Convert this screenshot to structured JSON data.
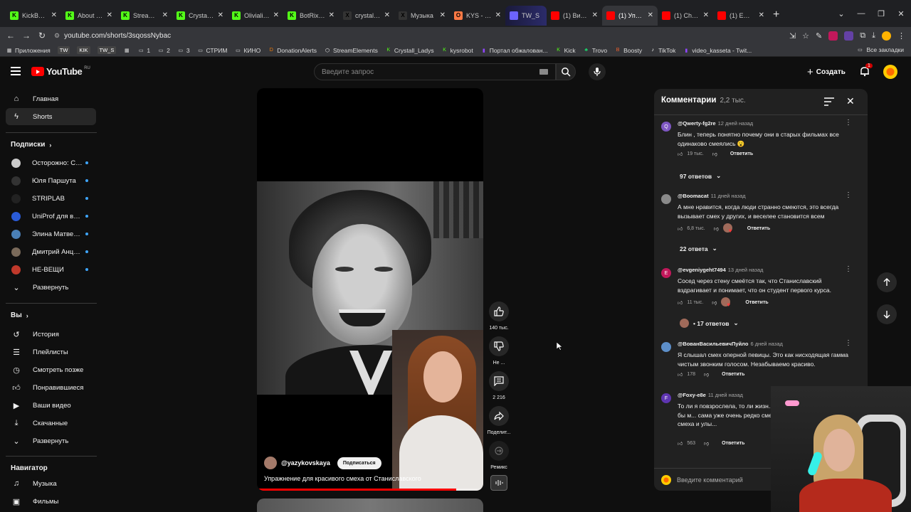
{
  "browser": {
    "tabs": [
      {
        "label": "KickBot Da",
        "fav_color": "#53fc18",
        "fav_text": "K",
        "active": false
      },
      {
        "label": "About Cry",
        "fav_color": "#53fc18",
        "fav_text": "K",
        "active": false
      },
      {
        "label": "Stream – K",
        "fav_color": "#53fc18",
        "fav_text": "K",
        "active": false
      },
      {
        "label": "Crystall_La",
        "fav_color": "#53fc18",
        "fav_text": "K",
        "active": false
      },
      {
        "label": "Olivialive",
        "fav_color": "#53fc18",
        "fav_text": "K",
        "active": false
      },
      {
        "label": "BotRix Str",
        "fav_color": "#53fc18",
        "fav_text": "K",
        "active": false
      },
      {
        "label": "crystall_la",
        "fav_color": "#333333",
        "fav_text": "X",
        "active": false
      },
      {
        "label": "Музыка",
        "fav_color": "#333333",
        "fav_text": "X",
        "active": false
      },
      {
        "label": "KYS - экс",
        "fav_color": "#ff7a45",
        "fav_text": "O",
        "active": false
      },
      {
        "label": "TW_S",
        "fav_color": "#6c63ff",
        "fav_text": "",
        "active": false,
        "special": true
      },
      {
        "label": "(1) Викто",
        "fav_color": "#ff0000",
        "fav_text": "",
        "active": false
      },
      {
        "label": "(1) Упраж",
        "fav_color": "#ff0000",
        "fav_text": "",
        "active": true
      },
      {
        "label": "(1) Chill D",
        "fav_color": "#ff0000",
        "fav_text": "",
        "active": false
      },
      {
        "label": "(1) EMIN",
        "fav_color": "#ff0000",
        "fav_text": "",
        "active": false
      }
    ],
    "url": "youtube.com/shorts/3sqossNybac",
    "bookmarks": [
      {
        "label": "Приложения",
        "icon": "apps-icon"
      },
      {
        "label": "TW",
        "icon": "chip"
      },
      {
        "label": "KIK",
        "icon": "chip"
      },
      {
        "label": "TW_S",
        "icon": "chip"
      },
      {
        "label": "",
        "icon": "grid-icon"
      },
      {
        "label": "1",
        "icon": "folder-icon"
      },
      {
        "label": "2",
        "icon": "folder-icon"
      },
      {
        "label": "3",
        "icon": "folder-icon"
      },
      {
        "label": "СТРИМ",
        "icon": "folder-icon"
      },
      {
        "label": "КИНО",
        "icon": "folder-icon"
      },
      {
        "label": "DonationAlerts",
        "icon": "donation-icon"
      },
      {
        "label": "StreamElements",
        "icon": "se-icon"
      },
      {
        "label": "Crystall_Ladys",
        "icon": "kick-icon"
      },
      {
        "label": "kysrobot",
        "icon": "kick-icon"
      },
      {
        "label": "Портал обжалован...",
        "icon": "twitch-icon"
      },
      {
        "label": "Kick",
        "icon": "kick-icon"
      },
      {
        "label": "Trovo",
        "icon": "trovo-icon"
      },
      {
        "label": "Boosty",
        "icon": "boosty-icon"
      },
      {
        "label": "TikTok",
        "icon": "tiktok-icon"
      },
      {
        "label": "video_kasseta - Twit...",
        "icon": "twitch-icon"
      }
    ],
    "all_bookmarks": "Все закладки"
  },
  "youtube": {
    "logo_region": "RU",
    "logo_word": "YouTube",
    "search_placeholder": "Введите запрос",
    "create_label": "Создать",
    "notif_count": "1"
  },
  "sidebar": {
    "main": [
      {
        "label": "Главная",
        "icon": "home-icon"
      },
      {
        "label": "Shorts",
        "icon": "shorts-icon",
        "active": true
      }
    ],
    "subs_title": "Подписки",
    "subs": [
      {
        "label": "Осторожно: Соб...",
        "color": "#cccccc"
      },
      {
        "label": "Юля Паршута",
        "color": "#333333"
      },
      {
        "label": "STRIPLAB",
        "color": "#222222"
      },
      {
        "label": "UniProf для вра...",
        "color": "#2a5bd7"
      },
      {
        "label": "Элина Матвеева",
        "color": "#4a7fb5"
      },
      {
        "label": "Дмитрий Анцуп...",
        "color": "#7a6a5a"
      },
      {
        "label": "НЕ-ВЕЩИ",
        "color": "#c0392b"
      }
    ],
    "expand_label": "Развернуть",
    "you_title": "Вы",
    "you": [
      {
        "label": "История",
        "icon": "history-icon"
      },
      {
        "label": "Плейлисты",
        "icon": "playlists-icon"
      },
      {
        "label": "Смотреть позже",
        "icon": "watch-later-icon"
      },
      {
        "label": "Понравившиеся",
        "icon": "like-icon"
      },
      {
        "label": "Ваши видео",
        "icon": "your-videos-icon"
      },
      {
        "label": "Скачанные",
        "icon": "download-icon"
      },
      {
        "label": "Развернуть",
        "icon": "chevron-down-icon"
      }
    ],
    "nav_title": "Навигатор",
    "nav": [
      {
        "label": "Музыка",
        "icon": "music-icon"
      },
      {
        "label": "Фильмы",
        "icon": "film-icon"
      }
    ]
  },
  "short": {
    "channel": "@yazykovskaya",
    "subscribe": "Подписаться",
    "title": "Упражнение для красивого смеха от Станиславского",
    "progress": 0.88,
    "likes": "140 тыс.",
    "dislike": "Не ...",
    "comments": "2 216",
    "share": "Поделит...",
    "remix": "Ремикс"
  },
  "comments": {
    "title": "Комментарии",
    "count": "2,2 тыс.",
    "input_placeholder": "Введите комментарий",
    "items": [
      {
        "user": "@Qwerty-fg2re",
        "ago": "12 дней назад",
        "avatar": "Q",
        "color": "#7e57c2",
        "text": "Блин , теперь понятно почему они в старых фильмах все одинаково смеялись 😮",
        "likes": "19 тыс.",
        "reply": "Ответить",
        "creator_heart": false,
        "replies": "97 ответов"
      },
      {
        "user": "@Boomacat",
        "ago": "11 дней назад",
        "avatar": "",
        "color": "#8a8a8a",
        "text": "А мне нравится, когда люди странно смеются, это всегда вызывает смех у других, и веселее становится всем",
        "likes": "6,8 тыс.",
        "reply": "Ответить",
        "creator_heart": true,
        "replies": "22 ответа"
      },
      {
        "user": "@evgeniygeht7494",
        "ago": "13 дней назад",
        "avatar": "E",
        "color": "#c2185b",
        "text": "Сосед через стену смеётся так, что Станиславский вздрагивает и понимает, что он студент первого курса.",
        "likes": "11 тыс.",
        "reply": "Ответить",
        "creator_heart": true,
        "replies": "• 17 ответов"
      },
      {
        "user": "@ВованВасильевичПуйло",
        "ago": "6 дней назад",
        "avatar": "",
        "color": "#5d8fc9",
        "text": "Я слышал смех оперной певицы. Это как нисходящая гамма чистым звонким голосом. Незабываемо красиво.",
        "likes": "178",
        "reply": "Ответить",
        "creator_heart": false,
        "replies": ""
      },
      {
        "user": "@Foxy-e8e",
        "ago": "11 дней назад",
        "avatar": "F",
        "color": "#5e35b1",
        "text": "То ли я повзрослела, то ли жизн... заметила, что люди будто бы м... сама уже очень редко смеюсь). ... просто искреннего смеха и улы...",
        "likes": "563",
        "reply": "Ответить",
        "creator_heart": false,
        "replies": ""
      }
    ]
  }
}
